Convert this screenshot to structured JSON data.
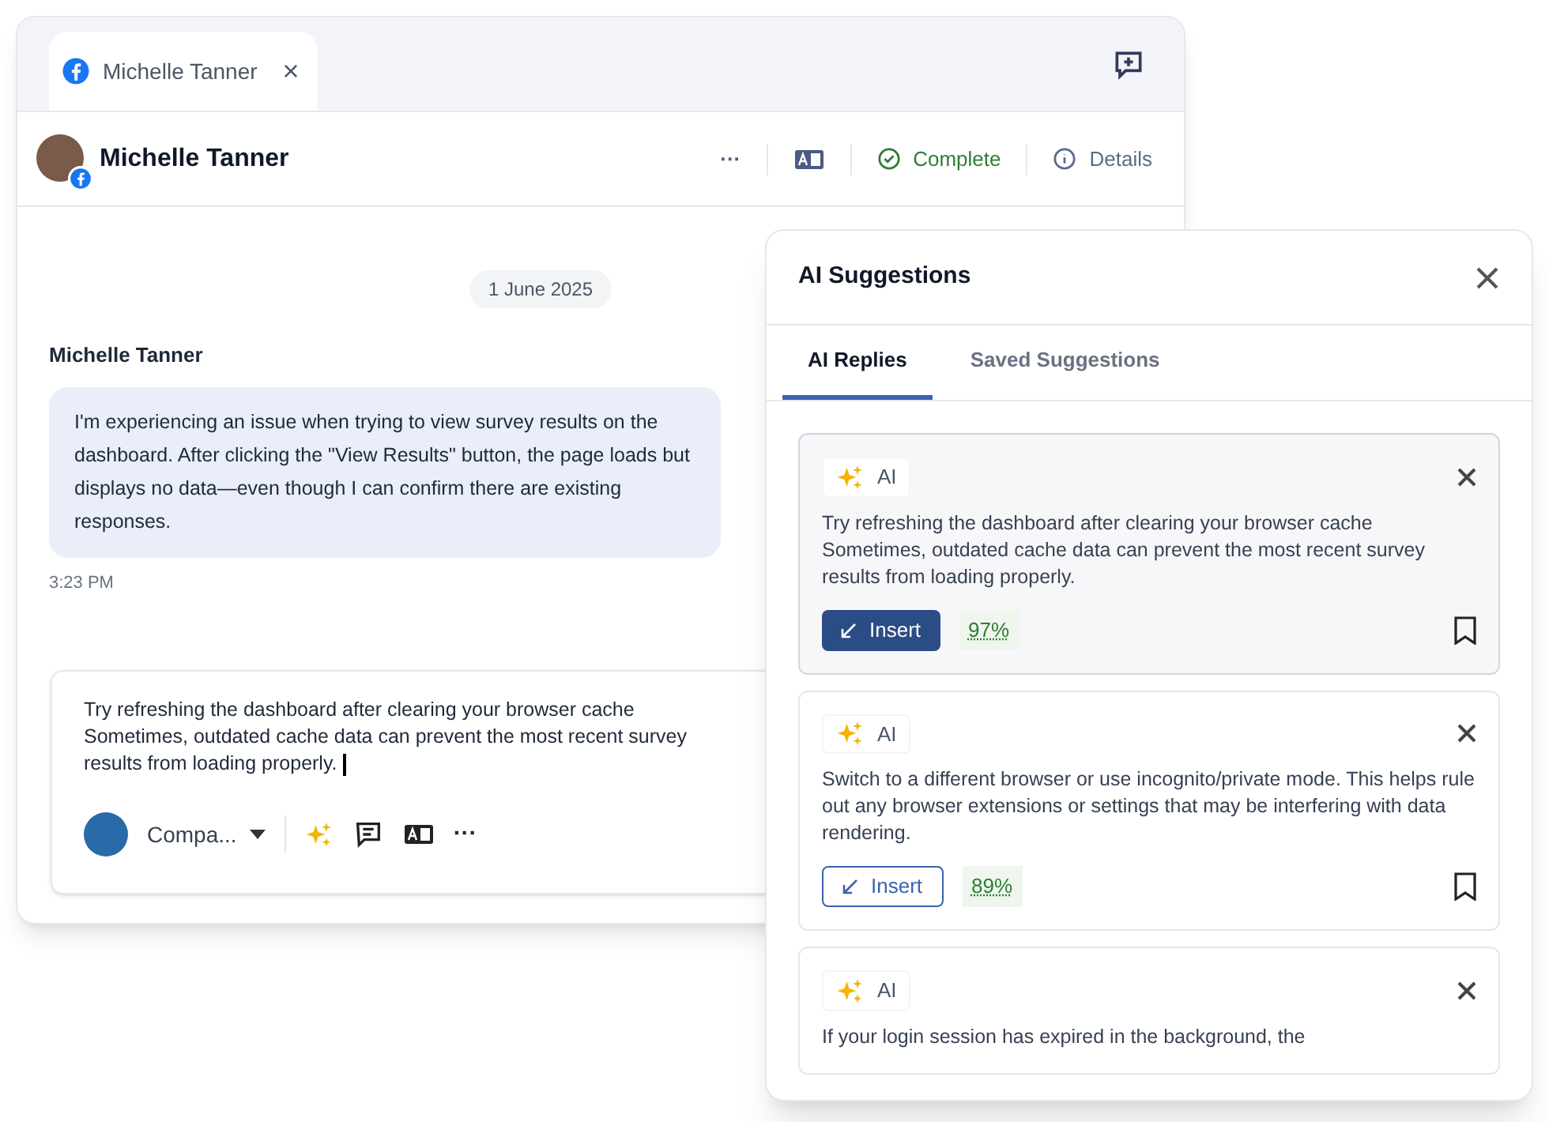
{
  "tab": {
    "title": "Michelle Tanner",
    "close": "×"
  },
  "header": {
    "name": "Michelle Tanner",
    "more": "···",
    "status": "Complete",
    "details": "Details"
  },
  "conversation": {
    "date": "1 June 2025",
    "sender": "Michelle Tanner",
    "message": "I'm experiencing an issue when trying to view survey results on the dashboard. After clicking the \"View Results\" button, the page loads but displays no data—even though I can confirm there are existing responses.",
    "time": "3:23 PM"
  },
  "composer": {
    "value": "Try refreshing the dashboard after clearing your browser cache Sometimes, outdated cache data can prevent the most recent survey results from loading properly.",
    "account": "Compa...",
    "more": "···"
  },
  "panel": {
    "title": "AI Suggestions",
    "tabs": [
      {
        "label": "AI Replies",
        "selected": true
      },
      {
        "label": "Saved Suggestions",
        "selected": false
      }
    ],
    "suggestions": [
      {
        "badge": "AI",
        "text": "Try refreshing the dashboard after clearing your browser cache Sometimes, outdated cache data can prevent the most recent survey results from loading properly.",
        "insert": "Insert",
        "score": "97%",
        "selected": true
      },
      {
        "badge": "AI",
        "text": "Switch to a different browser or use incognito/private mode. This helps rule out any browser extensions or settings that may be interfering with data rendering.",
        "insert": "Insert",
        "score": "89%",
        "selected": false
      },
      {
        "badge": "AI",
        "text": "If your login session has expired in the background, the",
        "selected": false
      }
    ]
  }
}
